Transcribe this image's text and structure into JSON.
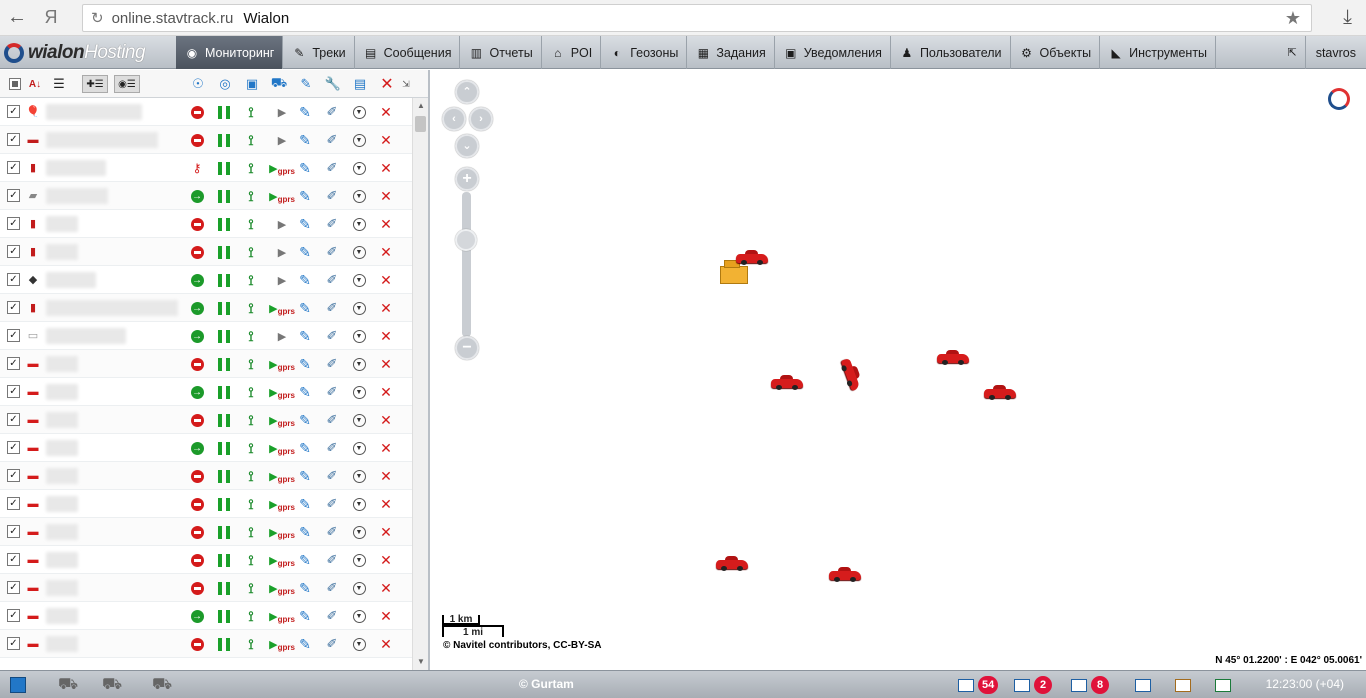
{
  "browser": {
    "back_icon": "back-arrow-icon",
    "yandex_icon": "Я",
    "url": "online.stavtrack.ru",
    "title": "Wialon"
  },
  "app": {
    "logo_wialon": "wialon",
    "logo_hosting": "Hosting"
  },
  "menu": {
    "items": [
      {
        "label": "Мониторинг",
        "icon": "globe-icon",
        "active": true
      },
      {
        "label": "Треки",
        "icon": "track-icon"
      },
      {
        "label": "Сообщения",
        "icon": "messages-icon"
      },
      {
        "label": "Отчеты",
        "icon": "reports-icon"
      },
      {
        "label": "POI",
        "icon": "poi-icon"
      },
      {
        "label": "Геозоны",
        "icon": "geofence-icon"
      },
      {
        "label": "Задания",
        "icon": "jobs-icon"
      },
      {
        "label": "Уведомления",
        "icon": "notifications-icon"
      },
      {
        "label": "Пользователи",
        "icon": "users-icon"
      },
      {
        "label": "Объекты",
        "icon": "units-icon"
      },
      {
        "label": "Инструменты",
        "icon": "tools-icon"
      }
    ],
    "user": "stavros"
  },
  "units": [
    {
      "vehicle": "balloon",
      "state": "stop",
      "gprs": false
    },
    {
      "vehicle": "bus",
      "state": "stop",
      "gprs": false
    },
    {
      "vehicle": "car-top",
      "state": "key",
      "gprs": true
    },
    {
      "vehicle": "truck",
      "state": "go",
      "gprs": true
    },
    {
      "vehicle": "car-top",
      "state": "stop",
      "gprs": false
    },
    {
      "vehicle": "car-top",
      "state": "stop",
      "gprs": false
    },
    {
      "vehicle": "tractor",
      "state": "go",
      "gprs": false
    },
    {
      "vehicle": "car-top",
      "state": "go",
      "gprs": true
    },
    {
      "vehicle": "van",
      "state": "go",
      "gprs": false
    },
    {
      "vehicle": "car",
      "state": "stop",
      "gprs": true
    },
    {
      "vehicle": "car",
      "state": "go",
      "gprs": true
    },
    {
      "vehicle": "car",
      "state": "stop",
      "gprs": true
    },
    {
      "vehicle": "car",
      "state": "go",
      "gprs": true
    },
    {
      "vehicle": "car",
      "state": "stop",
      "gprs": true
    },
    {
      "vehicle": "car",
      "state": "stop",
      "gprs": true
    },
    {
      "vehicle": "car",
      "state": "stop",
      "gprs": true
    },
    {
      "vehicle": "car",
      "state": "stop",
      "gprs": true
    },
    {
      "vehicle": "car",
      "state": "stop",
      "gprs": true
    },
    {
      "vehicle": "car",
      "state": "go",
      "gprs": true
    },
    {
      "vehicle": "car",
      "state": "stop",
      "gprs": true
    }
  ],
  "gprs_label": "gprs",
  "map": {
    "scale_km": "1 km",
    "scale_mi": "1 mi",
    "copyright": "© Navitel contributors, CC-BY-SA",
    "coords": "N 45° 01.2200' : E 042° 05.0061'"
  },
  "bottom": {
    "gurtam": "© Gurtam",
    "messages_count": "54",
    "commands_count": "2",
    "images_count": "8",
    "clock": "12:23:00 (+04)"
  },
  "colors": {
    "accent_red": "#d41b1b",
    "accent_green": "#1aa02a",
    "badge": "#e0123a"
  }
}
